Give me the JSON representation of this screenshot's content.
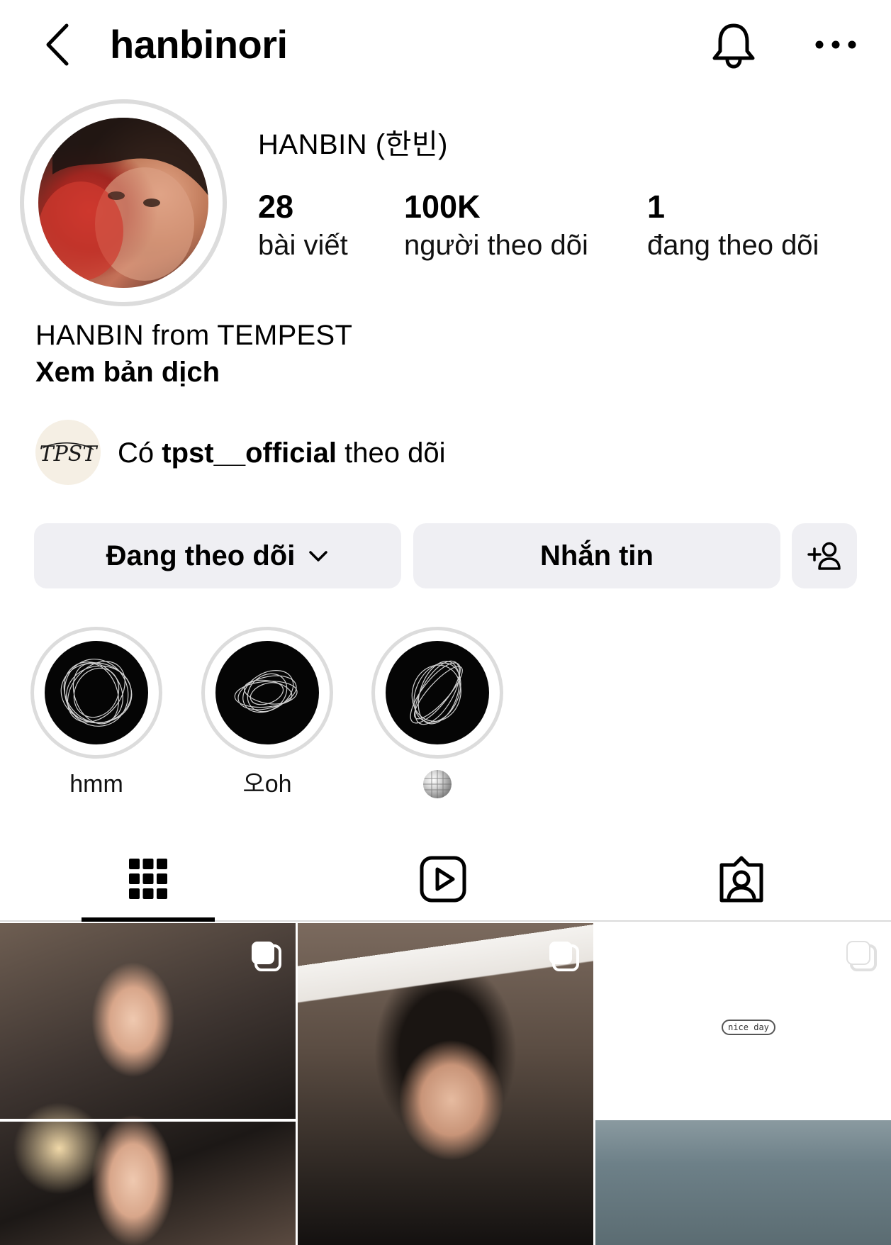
{
  "header": {
    "username": "hanbinori"
  },
  "profile": {
    "display_name": "HANBIN (한빈)",
    "stats": [
      {
        "value": "28",
        "label": "bài viết"
      },
      {
        "value": "100K",
        "label": "người theo dõi"
      },
      {
        "value": "1",
        "label": "đang theo dõi"
      }
    ],
    "bio": "HANBIN from TEMPEST",
    "translate_link": "Xem bản dịch",
    "followed_by_prefix": "Có",
    "followed_by_account": "tpst__official",
    "followed_by_suffix": "theo dõi",
    "mutual_avatar_logo": "TPST"
  },
  "actions": {
    "following_label": "Đang theo dõi",
    "message_label": "Nhắn tin"
  },
  "highlights": [
    {
      "label": "hmm",
      "icon": "scribble"
    },
    {
      "label": "오oh",
      "icon": "scribble"
    },
    {
      "label": "",
      "icon": "disco-ball-emoji"
    }
  ],
  "tabs": [
    {
      "icon": "grid-icon",
      "active": true
    },
    {
      "icon": "reels-icon",
      "active": false
    },
    {
      "icon": "tagged-icon",
      "active": false
    }
  ],
  "posts": [
    {
      "type": "carousel"
    },
    {
      "type": "carousel"
    },
    {
      "type": "carousel",
      "caption": "nice day"
    }
  ],
  "colors": {
    "button_bg": "#efeff3",
    "ring_gray": "#dcdcdc",
    "divider": "#dbdbdb"
  }
}
